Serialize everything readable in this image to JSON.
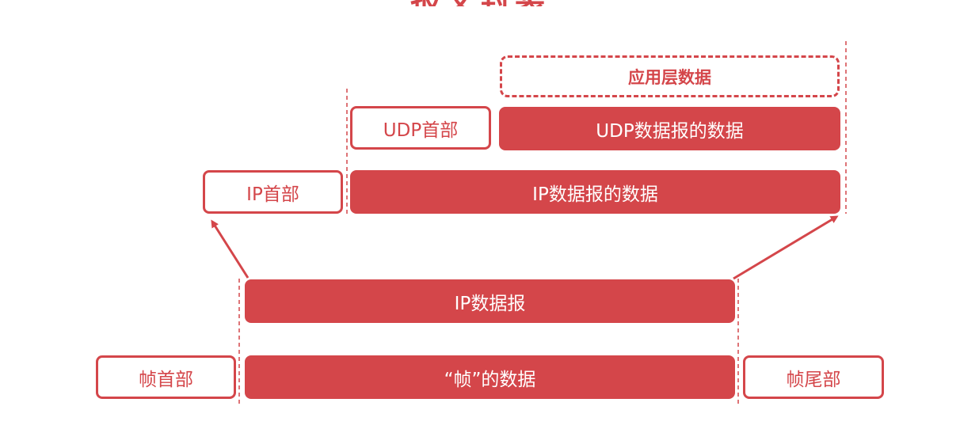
{
  "title": "报文封装",
  "layers": {
    "application": {
      "data": "应用层数据"
    },
    "udp": {
      "header": "UDP首部",
      "data": "UDP数据报的数据"
    },
    "ip": {
      "header": "IP首部",
      "data": "IP数据报的数据"
    },
    "datagram": {
      "label": "IP数据报"
    },
    "frame": {
      "header": "帧首部",
      "data": "“帧”的数据",
      "trailer": "帧尾部"
    }
  },
  "colors": {
    "accent": "#d4464a",
    "background": "#ffffff"
  }
}
